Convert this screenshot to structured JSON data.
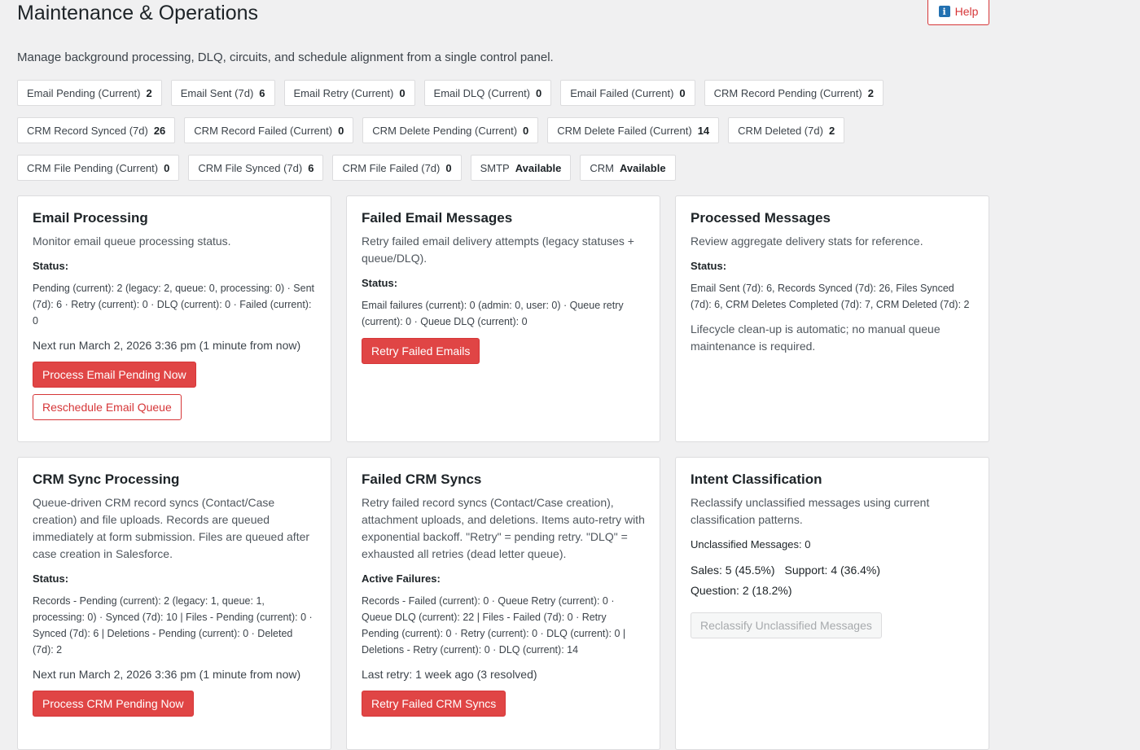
{
  "page": {
    "title": "Maintenance & Operations",
    "help_label": "Help",
    "description": "Manage background processing, DLQ, circuits, and schedule alignment from a single control panel."
  },
  "stats": [
    {
      "label": "Email Pending (Current)",
      "value": "2"
    },
    {
      "label": "Email Sent (7d)",
      "value": "6"
    },
    {
      "label": "Email Retry (Current)",
      "value": "0"
    },
    {
      "label": "Email DLQ (Current)",
      "value": "0"
    },
    {
      "label": "Email Failed (Current)",
      "value": "0"
    },
    {
      "label": "CRM Record Pending (Current)",
      "value": "2"
    },
    {
      "label": "CRM Record Synced (7d)",
      "value": "26"
    },
    {
      "label": "CRM Record Failed (Current)",
      "value": "0"
    },
    {
      "label": "CRM Delete Pending (Current)",
      "value": "0"
    },
    {
      "label": "CRM Delete Failed (Current)",
      "value": "14"
    },
    {
      "label": "CRM Deleted (7d)",
      "value": "2"
    },
    {
      "label": "CRM File Pending (Current)",
      "value": "0"
    },
    {
      "label": "CRM File Synced (7d)",
      "value": "6"
    },
    {
      "label": "CRM File Failed (7d)",
      "value": "0"
    },
    {
      "label": "SMTP",
      "value": "Available"
    },
    {
      "label": "CRM",
      "value": "Available"
    }
  ],
  "cards": {
    "email_processing": {
      "title": "Email Processing",
      "subtitle": "Monitor email queue processing status.",
      "status_label": "Status:",
      "status_text": "Pending (current): 2 (legacy: 2, queue: 0, processing: 0) · Sent (7d): 6 · Retry (current): 0 · DLQ (current): 0 · Failed (current): 0",
      "next_run": "Next run March 2, 2026 3:36 pm (1 minute from now)",
      "primary_button": "Process Email Pending Now",
      "secondary_button": "Reschedule Email Queue"
    },
    "failed_email": {
      "title": "Failed Email Messages",
      "subtitle": "Retry failed email delivery attempts (legacy statuses + queue/DLQ).",
      "status_label": "Status:",
      "status_text": "Email failures (current): 0 (admin: 0, user: 0) · Queue retry (current): 0 · Queue DLQ (current): 0",
      "primary_button": "Retry Failed Emails"
    },
    "processed_messages": {
      "title": "Processed Messages",
      "subtitle": "Review aggregate delivery stats for reference.",
      "status_label": "Status:",
      "status_text": "Email Sent (7d): 6, Records Synced (7d): 26, Files Synced (7d): 6, CRM Deletes Completed (7d): 7, CRM Deleted (7d): 2",
      "note": "Lifecycle clean-up is automatic; no manual queue maintenance is required."
    },
    "crm_sync": {
      "title": "CRM Sync Processing",
      "subtitle": "Queue-driven CRM record syncs (Contact/Case creation) and file uploads. Records are queued immediately at form submission. Files are queued after case creation in Salesforce.",
      "status_label": "Status:",
      "status_text": "Records - Pending (current): 2 (legacy: 1, queue: 1, processing: 0) · Synced (7d): 10 | Files - Pending (current): 0 · Synced (7d): 6 | Deletions - Pending (current): 0 · Deleted (7d): 2",
      "next_run": "Next run March 2, 2026 3:36 pm (1 minute from now)",
      "primary_button": "Process CRM Pending Now"
    },
    "failed_crm": {
      "title": "Failed CRM Syncs",
      "subtitle": "Retry failed record syncs (Contact/Case creation), attachment uploads, and deletions. Items auto-retry with exponential backoff. \"Retry\" = pending retry. \"DLQ\" = exhausted all retries (dead letter queue).",
      "status_label": "Active Failures:",
      "status_text": "Records - Failed (current): 0 · Queue Retry (current): 0 · Queue DLQ (current): 22 | Files - Failed (7d): 0 · Retry Pending (current): 0 · Retry (current): 0 · DLQ (current): 0 | Deletions - Retry (current): 0 · DLQ (current): 14",
      "last_retry": "Last retry: 1 week ago (3 resolved)",
      "primary_button": "Retry Failed CRM Syncs"
    },
    "intent": {
      "title": "Intent Classification",
      "subtitle": "Reclassify unclassified messages using current classification patterns.",
      "unclassified_label": "Unclassified Messages:",
      "unclassified_value": "0",
      "sales": "Sales: 5 (45.5%)",
      "support": "Support: 4 (36.4%)",
      "question": "Question: 2 (18.2%)",
      "button": "Reclassify Unclassified Messages"
    }
  }
}
